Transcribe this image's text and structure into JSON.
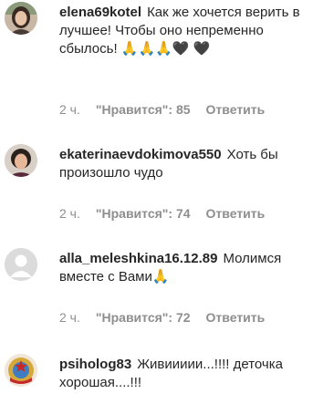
{
  "comments": [
    {
      "username": "elena69kotel",
      "text": "Как же хочется верить в лучшее! Чтобы оно непременно сбылось! 🙏🙏🙏🖤 🖤",
      "time": "2 ч.",
      "likes_label": "\"Нравится\": 85",
      "reply_label": "Ответить",
      "avatar_icon": "woman-profile-photo"
    },
    {
      "username": "ekaterinaevdokimova550",
      "text": "Хоть бы произошло чудо",
      "time": "2 ч.",
      "likes_label": "\"Нравится\": 74",
      "reply_label": "Ответить",
      "avatar_icon": "woman-profile-photo"
    },
    {
      "username": "alla_meleshkina16.12.89",
      "text": "Молимся вместе с Вами🙏",
      "time": "2 ч.",
      "likes_label": "\"Нравится\": 72",
      "reply_label": "Ответить",
      "avatar_icon": "default-user-icon"
    },
    {
      "username": "psiholog83",
      "text": "Живиииии...!!!! деточка хорошая....!!!",
      "avatar_icon": "ussr-emblem"
    }
  ],
  "colors": {
    "text": "#262626",
    "meta": "#8e8e8e",
    "placeholder_avatar": "#dbdbdb"
  }
}
